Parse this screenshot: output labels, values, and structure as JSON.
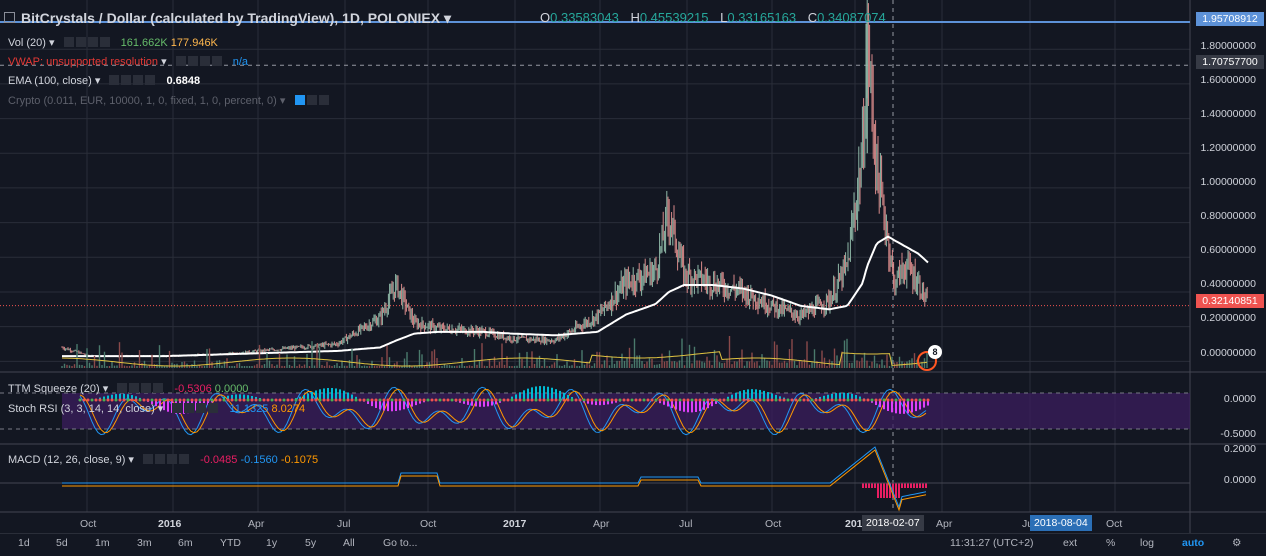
{
  "header": {
    "title": "BitCrystals / Dollar (calculated by TradingView), 1D, POLONIEX",
    "ohlc": [
      {
        "k": "O",
        "v": "0.33583043"
      },
      {
        "k": "H",
        "v": "0.45539215"
      },
      {
        "k": "L",
        "v": "0.33165163"
      },
      {
        "k": "C",
        "v": "0.34087074"
      }
    ]
  },
  "indicators": {
    "vol": {
      "label": "Vol (20)",
      "v1": "161.662K",
      "v2": "177.946K"
    },
    "vwap": {
      "label": "VWAP: unsupported resolution",
      "v": "n/a"
    },
    "ema": {
      "label": "EMA (100, close)",
      "v": "0.6848"
    },
    "crypto": {
      "label": "Crypto (0.011, EUR, 10000, 1, 0, fixed, 1, 0, percent, 0)"
    },
    "ttm": {
      "label": "TTM Squeeze (20)",
      "v1": "-0.5306",
      "v2": "0.0000"
    },
    "stoch": {
      "label": "Stoch RSI (3, 3, 14, 14, close)",
      "v1": "11.1325",
      "v2": "8.0274"
    },
    "macd": {
      "label": "MACD (12, 26, close, 9)",
      "v1": "-0.0485",
      "v2": "-0.1560",
      "v3": "-0.1075"
    }
  },
  "price_axis": {
    "ticks": [
      "1.80000000",
      "1.60000000",
      "1.40000000",
      "1.20000000",
      "1.00000000",
      "0.80000000",
      "0.60000000",
      "0.40000000",
      "0.20000000",
      "0.00000000"
    ],
    "tag_high": "1.95708912",
    "tag_cross": "1.70757700",
    "tag_last": "0.32140851"
  },
  "osc_axis": {
    "ticks": [
      "0.0000",
      "-0.5000"
    ]
  },
  "macd_axis": {
    "ticks": [
      "0.2000",
      "0.0000"
    ]
  },
  "time_axis": {
    "ticks": [
      "Oct",
      "2016",
      "Apr",
      "Jul",
      "Oct",
      "2017",
      "Apr",
      "Jul",
      "Oct",
      "201",
      "Apr",
      "Ju",
      "Oct"
    ],
    "cursor": "2018-02-07",
    "cursor2": "2018-08-04"
  },
  "event_badge": "8",
  "toolbar": {
    "ranges": [
      "1d",
      "5d",
      "1m",
      "3m",
      "6m",
      "YTD",
      "1y",
      "5y",
      "All"
    ],
    "goto": "Go to...",
    "time": "11:31:27 (UTC+2)",
    "opts": [
      "ext",
      "%",
      "log",
      "auto"
    ]
  },
  "colors": {
    "bg": "#131722",
    "grid": "#2a2e39",
    "candle_up": "#8fb9a8",
    "candle_down": "#d88a8a",
    "ema": "#ffffff",
    "vol_ma": "#e0c341",
    "k_line": "#2196f3",
    "d_line": "#ff9800",
    "macd": "#2196f3",
    "signal": "#ff9800",
    "hist_neg": "#e91e63",
    "stoch_band": "#3b1d5e",
    "tag_high": "#5d92d8",
    "tag_last": "#ef5350"
  },
  "chart_data": {
    "type": "line",
    "title": "BitCrystals / Dollar (calculated by TradingView), 1D, POLONIEX",
    "x": [
      "2015-09-15",
      "2015-10-15",
      "2015-12-01",
      "2016-01-01",
      "2016-03-01",
      "2016-05-01",
      "2016-07-01",
      "2016-08-15",
      "2016-09-01",
      "2016-09-20",
      "2016-10-15",
      "2016-12-01",
      "2017-01-01",
      "2017-02-15",
      "2017-04-01",
      "2017-05-01",
      "2017-06-01",
      "2017-06-15",
      "2017-07-01",
      "2017-08-01",
      "2017-09-01",
      "2017-10-01",
      "2017-11-01",
      "2017-12-01",
      "2017-12-20",
      "2018-01-05",
      "2018-01-10",
      "2018-01-20",
      "2018-02-01",
      "2018-02-07",
      "2018-02-20",
      "2018-03-05",
      "2018-03-15"
    ],
    "series": [
      {
        "name": "Price",
        "values": [
          0.08,
          0.03,
          0.03,
          0.03,
          0.04,
          0.07,
          0.1,
          0.25,
          0.44,
          0.22,
          0.19,
          0.17,
          0.13,
          0.12,
          0.26,
          0.45,
          0.52,
          0.85,
          0.5,
          0.45,
          0.4,
          0.32,
          0.26,
          0.35,
          0.55,
          1.2,
          1.85,
          1.1,
          0.7,
          0.45,
          0.55,
          0.45,
          0.32
        ]
      },
      {
        "name": "EMA (100, close)",
        "values": [
          0.03,
          0.03,
          0.03,
          0.03,
          0.04,
          0.05,
          0.06,
          0.08,
          0.12,
          0.16,
          0.17,
          0.17,
          0.16,
          0.15,
          0.17,
          0.27,
          0.33,
          0.4,
          0.44,
          0.44,
          0.42,
          0.38,
          0.32,
          0.3,
          0.32,
          0.45,
          0.55,
          0.68,
          0.72,
          0.7,
          0.66,
          0.62,
          0.57
        ]
      }
    ],
    "ylim": [
      -0.05,
      1.98
    ],
    "ylabel": "",
    "xlabel": ""
  }
}
